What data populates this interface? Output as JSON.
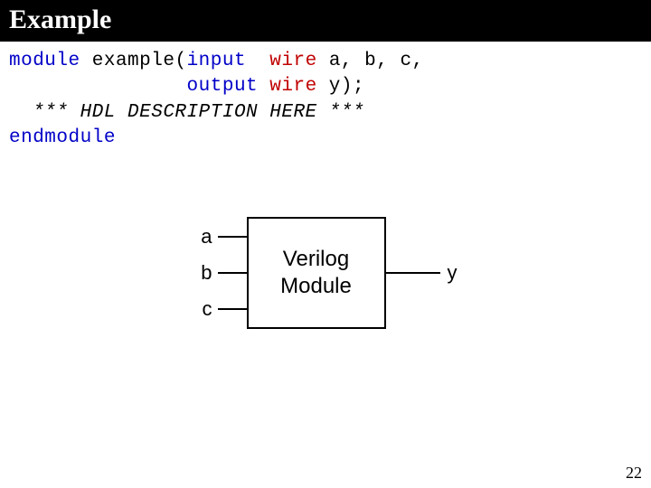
{
  "slide": {
    "title": "Example",
    "page_number": "22"
  },
  "code": {
    "line1": {
      "kw": "module",
      "name": "example",
      "open": "(",
      "dir": "input",
      "pad": "  ",
      "type": "wire",
      "ids": "a, b, c,"
    },
    "line2": {
      "indent": "               ",
      "dir": "output",
      "sp": " ",
      "type": "wire",
      "ids": "y);"
    },
    "line3": "  *** HDL DESCRIPTION HERE ***",
    "line4": "endmodule"
  },
  "diagram": {
    "inputs": [
      "a",
      "b",
      "c"
    ],
    "box_text_line1": "Verilog",
    "box_text_line2": "Module",
    "output": "y"
  }
}
